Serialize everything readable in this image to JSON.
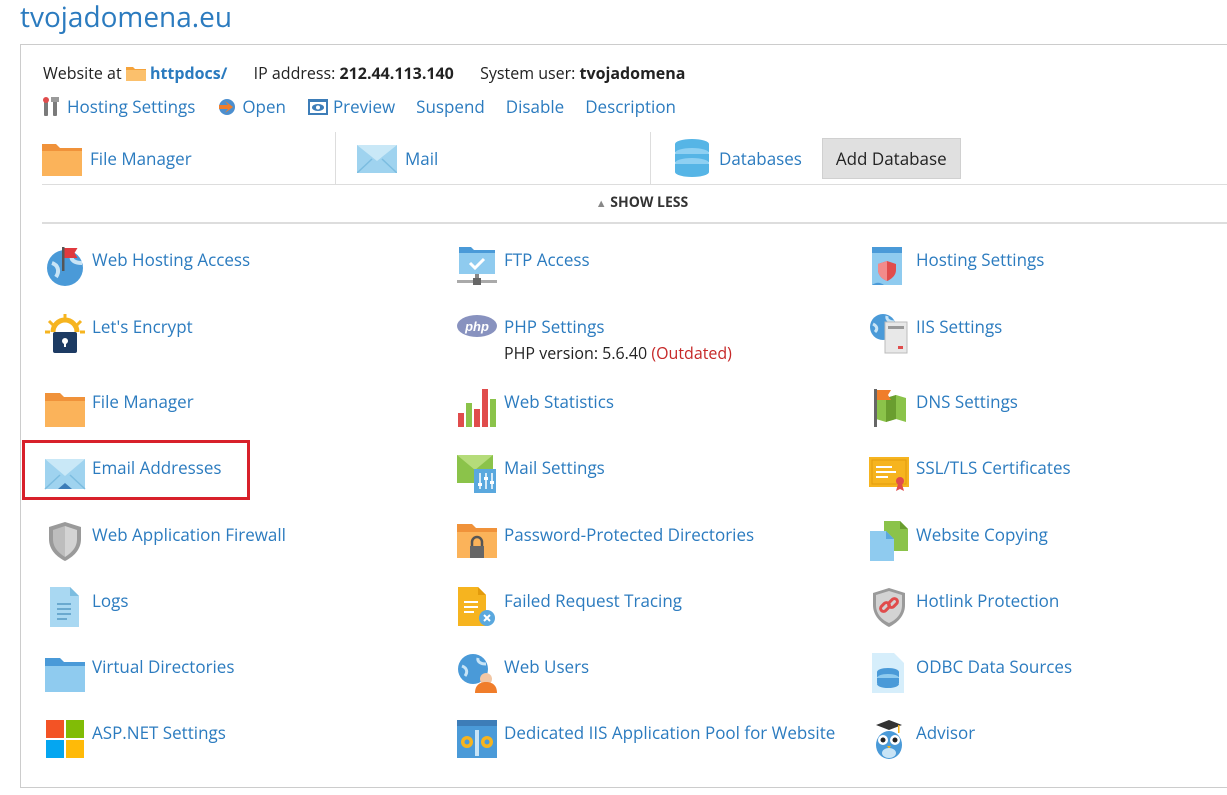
{
  "domain": "tvojadomena.eu",
  "info": {
    "website_at_label": "Website at",
    "docroot": "httpdocs/",
    "ip_label": "IP address:",
    "ip_value": "212.44.113.140",
    "user_label": "System user:",
    "user_value": "tvojadomena"
  },
  "actions": [
    "Hosting Settings",
    "Open",
    "Preview",
    "Suspend",
    "Disable",
    "Description"
  ],
  "quick": {
    "file_manager": "File Manager",
    "mail": "Mail",
    "databases": "Databases",
    "add_database": "Add Database"
  },
  "show_less": "SHOW LESS",
  "tools": {
    "c0": [
      "Web Hosting Access",
      "Let's Encrypt",
      "File Manager",
      "Email Addresses",
      "Web Application Firewall",
      "Logs",
      "Virtual Directories",
      "ASP.NET Settings"
    ],
    "c1": [
      "FTP Access",
      "PHP Settings",
      "Web Statistics",
      "Mail Settings",
      "Password-Protected Directories",
      "Failed Request Tracing",
      "Web Users",
      "Dedicated IIS Application Pool for Website"
    ],
    "c2": [
      "Hosting Settings",
      "IIS Settings",
      "DNS Settings",
      "SSL/TLS Certificates",
      "Website Copying",
      "Hotlink Protection",
      "ODBC Data Sources",
      "Advisor"
    ]
  },
  "php": {
    "version_label": "PHP version: 5.6.40",
    "status": "(Outdated)"
  },
  "colors": {
    "link": "#2b7bbf",
    "highlight": "#d8202a",
    "outdated": "#c62828"
  }
}
